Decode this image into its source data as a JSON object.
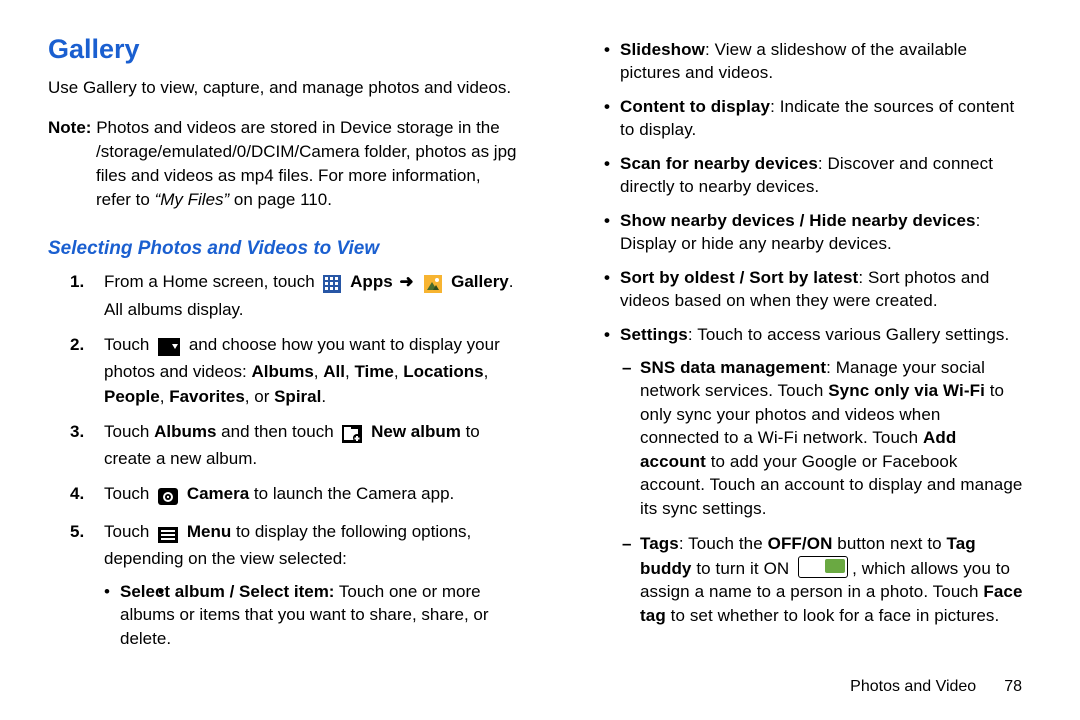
{
  "title": "Gallery",
  "intro": "Use Gallery to view, capture, and manage photos and videos.",
  "note": {
    "label": "Note:",
    "text_a": "Photos and videos are stored in Device storage in the /storage/emulated/0/DCIM/Camera folder, photos as jpg files and videos as mp4 files. For more information, refer to ",
    "ref": "“My Files”",
    "text_b": " on page 110."
  },
  "subhead": "Selecting Photos and Videos to View",
  "step1": {
    "a": "From a Home screen, touch ",
    "apps": "Apps",
    "arrow": "➜",
    "gallery": "Gallery",
    "b": ". All albums display."
  },
  "step2": {
    "a": "Touch ",
    "b": " and choose how you want to display your photos and videos: ",
    "opts": "Albums",
    "c": ", ",
    "all": "All",
    "c2": ", ",
    "time": "Time",
    "c3": ", ",
    "loc": "Locations",
    "c4": ", ",
    "people": "People",
    "c5": ", ",
    "fav": "Favorites",
    "c6": ", or ",
    "spiral": "Spiral",
    "d": "."
  },
  "step3": {
    "a": "Touch ",
    "albums": "Albums",
    "b": " and then touch ",
    "newalbum": "New album",
    "c": " to create a new album."
  },
  "step4": {
    "a": "Touch ",
    "camera": "Camera",
    "b": " to launch the Camera app."
  },
  "step5": {
    "a": "Touch ",
    "menu": "Menu",
    "b": " to display the following options, depending on the view selected:"
  },
  "left_bullets": {
    "b1_lbl": "Select album / Select item:",
    "b1_txt": " Touch one or more albums or items that you want to share, share, or delete."
  },
  "right_bullets": {
    "b1_lbl": "Slideshow",
    "b1_txt": ": View a slideshow of the available pictures and videos.",
    "b2_lbl": "Content to display",
    "b2_txt": ": Indicate the sources of content to display.",
    "b3_lbl": "Scan for nearby devices",
    "b3_txt": ": Discover and connect directly to nearby devices.",
    "b4_lbl": "Show nearby devices / Hide nearby devices",
    "b4_txt": ": Display or hide any nearby devices.",
    "b5_lbl": "Sort by oldest / Sort by latest",
    "b5_txt": ": Sort photos and videos based on when they were created.",
    "b6_lbl": "Settings",
    "b6_txt": ": Touch to access various Gallery settings."
  },
  "subs": {
    "s1_lbl": "SNS data management",
    "s1_a": ": Manage your social network services. Touch ",
    "s1_sync": "Sync only via Wi-Fi",
    "s1_b": " to only sync your photos and videos when connected to a Wi-Fi network. Touch ",
    "s1_add": "Add account",
    "s1_c": " to add your Google or Facebook account. Touch an account to display and manage its sync settings.",
    "s2_lbl": "Tags",
    "s2_a": ": Touch the ",
    "s2_offon": "OFF/ON",
    "s2_b": " button next to ",
    "s2_tagbuddy": "Tag buddy",
    "s2_c": " to turn it ON ",
    "s2_d": ", which allows you to assign a name to a person in a photo. Touch ",
    "s2_facetag": "Face tag",
    "s2_e": " to set whether to look for a face in pictures."
  },
  "footer": {
    "section": "Photos and Video",
    "page": "78"
  }
}
